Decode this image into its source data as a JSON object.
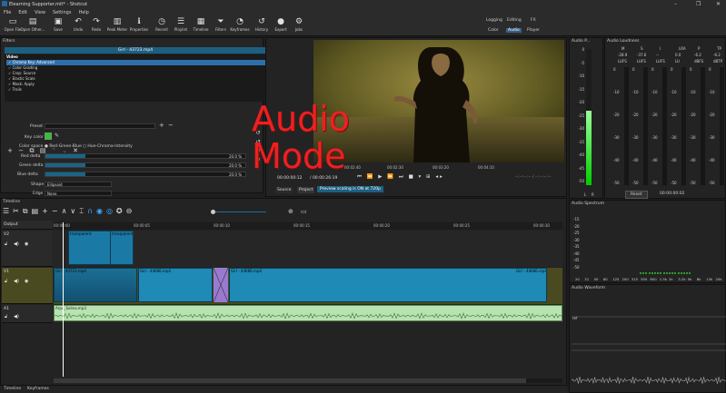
{
  "window": {
    "title": "Elearning Supporter.mlt* - Shotcut",
    "controls": [
      "–",
      "❐",
      "✕"
    ]
  },
  "menu": [
    "File",
    "Edit",
    "View",
    "Settings",
    "Help"
  ],
  "toolbar": [
    {
      "label": "Open File",
      "icon": "open-file-icon",
      "glyph": "▭"
    },
    {
      "label": "Open Other...",
      "icon": "open-other-icon",
      "glyph": "▤"
    },
    {
      "label": "Save",
      "icon": "save-icon",
      "glyph": "▣"
    },
    {
      "label": "Undo",
      "icon": "undo-icon",
      "glyph": "↶"
    },
    {
      "label": "Redo",
      "icon": "redo-icon",
      "glyph": "↷"
    },
    {
      "label": "Peak Meter",
      "icon": "peak-meter-icon",
      "glyph": "▥"
    },
    {
      "label": "Properties",
      "icon": "properties-icon",
      "glyph": "ℹ"
    },
    {
      "label": "Recent",
      "icon": "recent-icon",
      "glyph": "◷"
    },
    {
      "label": "Playlist",
      "icon": "playlist-icon",
      "glyph": "☰"
    },
    {
      "label": "Timeline",
      "icon": "timeline-icon",
      "glyph": "▦"
    },
    {
      "label": "Filters",
      "icon": "filters-icon",
      "glyph": "⏷"
    },
    {
      "label": "Keyframes",
      "icon": "keyframes-icon",
      "glyph": "◔"
    },
    {
      "label": "History",
      "icon": "history-icon",
      "glyph": "↺"
    },
    {
      "label": "Export",
      "icon": "export-icon",
      "glyph": "●"
    },
    {
      "label": "Jobs",
      "icon": "jobs-icon",
      "glyph": "⚙"
    }
  ],
  "layouts": {
    "top": [
      "Logging",
      "Editing",
      "FX"
    ],
    "bottom": [
      "Color",
      "Audio",
      "Player"
    ],
    "active": "Audio"
  },
  "filters": {
    "title": "Filters",
    "clip_name": "Girl - 43723.mp4",
    "group": "Video",
    "items": [
      "Chroma Key: Advanced",
      "Color Grading",
      "Crop: Source",
      "Elastic Scale",
      "Mask: Apply",
      "Trails"
    ],
    "selected_index": 0,
    "preset_label": "Preset",
    "key_color_label": "Key color",
    "key_color": "#22cc22",
    "color_space_label": "Color space",
    "color_space_options": [
      "Red-Green-Blue",
      "Hue-Chroma-Intensity"
    ],
    "sliders": [
      {
        "label": "Red delta",
        "value": "20.0 %",
        "fraction": 0.2
      },
      {
        "label": "Green delta",
        "value": "20.0 %",
        "fraction": 0.2
      },
      {
        "label": "Blue delta",
        "value": "20.0 %",
        "fraction": 0.2
      }
    ],
    "shape_label": "Shape",
    "shape_value": "Ellipsoid",
    "edge_label": "Edge",
    "edge_value": "None"
  },
  "overlay": {
    "line1": "Audio",
    "line2": "Mode"
  },
  "viewer": {
    "timecode": "00:00:00:12",
    "duration": "/ 00:00:26:19",
    "ruler": [
      "00:00:00",
      "00:02:40",
      "00:02:30",
      "00:03:20",
      "00:04:10"
    ],
    "tabs": [
      "Source",
      "Project"
    ],
    "preview_btn": "Preview scaling is ON at 720p"
  },
  "audio_peak": {
    "title": "Audio P...",
    "ticks": [
      "0",
      "-5",
      "-10",
      "-15",
      "-20",
      "-25",
      "-30",
      "-35",
      "-40",
      "-45",
      "-50"
    ],
    "level_fraction": 0.55,
    "bottom_labels": [
      "L",
      "R"
    ]
  },
  "audio_loudness": {
    "title": "Audio Loudness",
    "columns": [
      "M",
      "S",
      "I",
      "LRA",
      "P",
      "TP"
    ],
    "values": [
      "-28.9",
      "-37.6",
      "--",
      "0.0",
      "-6.2",
      "-6.2"
    ],
    "units": [
      "LUFS",
      "LUFS",
      "LUFS",
      "LU",
      "dBFS",
      "dBTP"
    ],
    "ticks": [
      "0",
      "-10",
      "-20",
      "-30",
      "-40",
      "-50"
    ],
    "reset": "Reset",
    "time": "00:00:00:02"
  },
  "audio_spectrum": {
    "title": "Audio Spectrum",
    "ticks": [
      "-15",
      "-20",
      "-25",
      "-30",
      "-35",
      "-40",
      "-45",
      "-50"
    ],
    "freqs": [
      "20",
      "31",
      "50",
      "80",
      "125",
      "200",
      "315",
      "500",
      "800",
      "1.3k",
      "2k",
      "3.2k",
      "5k",
      "8k",
      "13k",
      "20k"
    ]
  },
  "audio_waveform": {
    "title": "Audio Waveform",
    "label": "ref"
  },
  "timeline": {
    "title": "Timeline",
    "output_label": "Output",
    "ruler": [
      "00:00:00",
      "00:00:05",
      "00:00:10",
      "00:00:15",
      "00:00:20",
      "00:00:25",
      "00:00:30"
    ],
    "tracks": [
      {
        "name": "V2",
        "clips": [
          "transparent",
          "transparent"
        ]
      },
      {
        "name": "V1",
        "clips": [
          "Girl - 43723.mp4",
          "Girl - 44686.mp4",
          "Girl - 44686.mp4",
          "Girl - 44686.mp4"
        ]
      },
      {
        "name": "A1",
        "clips": [
          "Arpu_Solina.mp3"
        ]
      }
    ]
  },
  "bottom_tabs": [
    "Timeline",
    "Keyframes"
  ]
}
